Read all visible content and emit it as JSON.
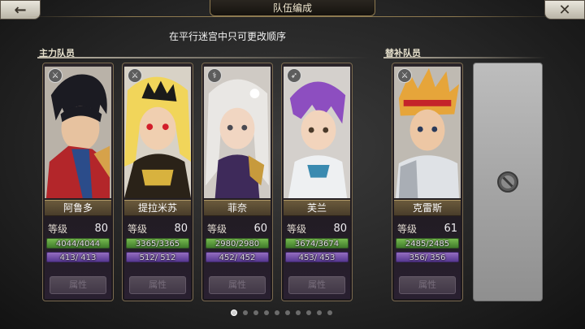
{
  "header": {
    "title": "队伍编成",
    "back_icon": "back-arrow-icon",
    "close_icon": "close-x-icon"
  },
  "notice": "在平行迷宫中只可更改顺序",
  "sections": {
    "main_label": "主力队员",
    "reserve_label": "替补队员"
  },
  "labels": {
    "level": "等级",
    "attributes_button": "属性"
  },
  "main_members": [
    {
      "name": "阿鲁多",
      "level": "80",
      "hp": "4044/4044",
      "mp": "413/ 413",
      "weapon": "sword-icon",
      "hp_fraction": 1,
      "mp_fraction": 1
    },
    {
      "name": "提拉米苏",
      "level": "80",
      "hp": "3365/3365",
      "mp": "512/ 512",
      "weapon": "sword-icon",
      "hp_fraction": 1,
      "mp_fraction": 1
    },
    {
      "name": "菲奈",
      "level": "60",
      "hp": "2980/2980",
      "mp": "452/ 452",
      "weapon": "staff-icon",
      "hp_fraction": 1,
      "mp_fraction": 1
    },
    {
      "name": "芙兰",
      "level": "80",
      "hp": "3674/3674",
      "mp": "453/ 453",
      "weapon": "bow-icon",
      "hp_fraction": 1,
      "mp_fraction": 1
    }
  ],
  "reserve_members": [
    {
      "name": "克雷斯",
      "level": "61",
      "hp": "2485/2485",
      "mp": "356/ 356",
      "weapon": "sword-icon",
      "hp_fraction": 1,
      "mp_fraction": 1
    }
  ],
  "empty_slot_icon": "prohibited-icon",
  "pagination": {
    "total_pages": 10,
    "current_page": 1
  },
  "colors": {
    "hp_bar": "#5fb338",
    "mp_bar": "#7d55bf",
    "name_plate": "#5a4b32",
    "frame_gold": "#8e7a50"
  }
}
